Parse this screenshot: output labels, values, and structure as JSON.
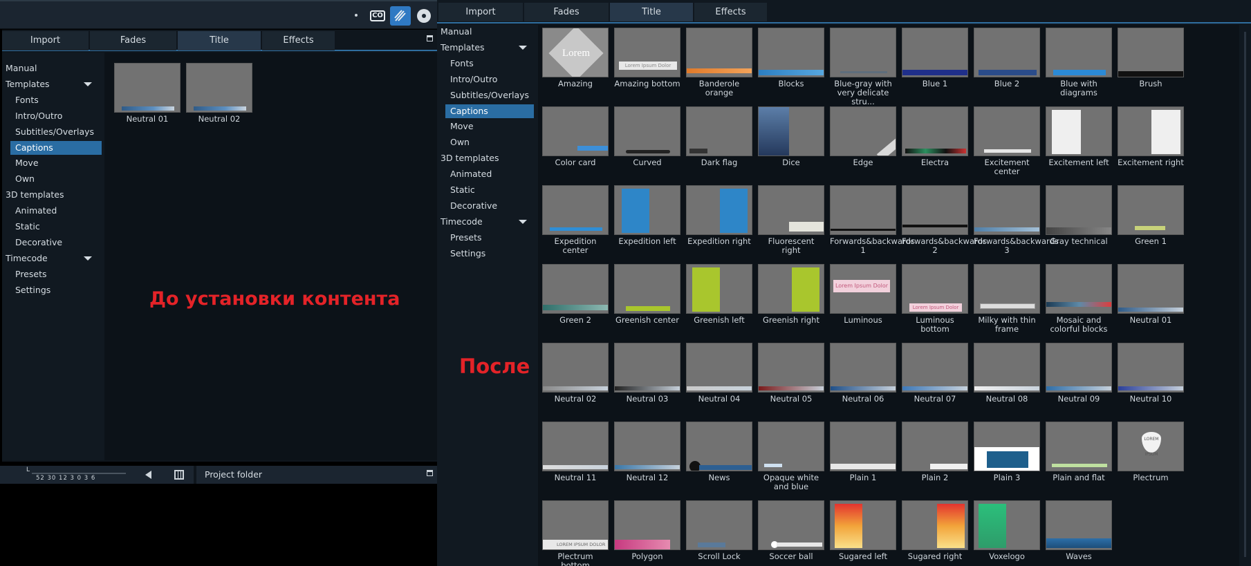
{
  "before": {
    "tabs": [
      "Import",
      "Fades",
      "Title",
      "Effects"
    ],
    "active_tab": 2,
    "nav": [
      {
        "label": "Manual",
        "level": 0
      },
      {
        "label": "Templates",
        "level": 0,
        "caret": true
      },
      {
        "label": "Fonts",
        "level": 1
      },
      {
        "label": "Intro/Outro",
        "level": 1
      },
      {
        "label": "Subtitles/Overlays",
        "level": 1
      },
      {
        "label": "Captions",
        "level": 1,
        "selected": true
      },
      {
        "label": "Move",
        "level": 1
      },
      {
        "label": "Own",
        "level": 1
      },
      {
        "label": "3D templates",
        "level": 0
      },
      {
        "label": "Animated",
        "level": 1
      },
      {
        "label": "Static",
        "level": 1
      },
      {
        "label": "Decorative",
        "level": 1
      },
      {
        "label": "Timecode",
        "level": 0,
        "caret": true
      },
      {
        "label": "Presets",
        "level": 1
      },
      {
        "label": "Settings",
        "level": 1
      }
    ],
    "templates": [
      "Neutral 01",
      "Neutral 02"
    ],
    "toolbar_icons": [
      "co-icon",
      "pen-tool-icon",
      "disc-icon"
    ],
    "mixer": {
      "channel": "L",
      "scale": "52  30   12      3  0  3  6"
    },
    "project_folder": "Project folder",
    "annotation": "До установки контента"
  },
  "after": {
    "tabs": [
      "Import",
      "Fades",
      "Title",
      "Effects"
    ],
    "active_tab": 2,
    "nav": [
      {
        "label": "Manual",
        "level": 0
      },
      {
        "label": "Templates",
        "level": 0,
        "caret": true
      },
      {
        "label": "Fonts",
        "level": 1
      },
      {
        "label": "Intro/Outro",
        "level": 1
      },
      {
        "label": "Subtitles/Overlays",
        "level": 1
      },
      {
        "label": "Captions",
        "level": 1,
        "selected": true
      },
      {
        "label": "Move",
        "level": 1
      },
      {
        "label": "Own",
        "level": 1
      },
      {
        "label": "3D templates",
        "level": 0
      },
      {
        "label": "Animated",
        "level": 1
      },
      {
        "label": "Static",
        "level": 1
      },
      {
        "label": "Decorative",
        "level": 1
      },
      {
        "label": "Timecode",
        "level": 0,
        "caret": true
      },
      {
        "label": "Presets",
        "level": 1
      },
      {
        "label": "Settings",
        "level": 1
      }
    ],
    "templates": [
      "Amazing",
      "Amazing bottom",
      "Banderole orange",
      "Blocks",
      "Blue-gray with very delicate stru...",
      "Blue 1",
      "Blue 2",
      "Blue with diagrams",
      "Brush",
      "Color card",
      "Curved",
      "Dark flag",
      "Dice",
      "Edge",
      "Electra",
      "Excitement center",
      "Excitement left",
      "Excitement right",
      "Expedition center",
      "Expedition left",
      "Expedition right",
      "Fluorescent right",
      "Forwards&backwards 1",
      "Forwards&backwards 2",
      "Forwards&backwards 3",
      "Gray technical",
      "Green 1",
      "Green 2",
      "Greenish center",
      "Greenish left",
      "Greenish right",
      "Luminous",
      "Luminous bottom",
      "Milky with thin frame",
      "Mosaic and colorful blocks",
      "Neutral 01",
      "Neutral 02",
      "Neutral 03",
      "Neutral 04",
      "Neutral 05",
      "Neutral 06",
      "Neutral 07",
      "Neutral 08",
      "Neutral 09",
      "Neutral 10",
      "Neutral 11",
      "Neutral 12",
      "News",
      "Opaque white and blue",
      "Plain 1",
      "Plain 2",
      "Plain 3",
      "Plain and flat",
      "Plectrum",
      "Plectrum bottom",
      "Polygon",
      "Scroll Lock",
      "Soccer ball",
      "Sugared left",
      "Sugared right",
      "Voxelogo",
      "Waves"
    ],
    "thumb_text": {
      "lorem": "Lorem",
      "lorem_ipsum_dolor": "Lorem Ipsum Dolor",
      "lorem_ipsum": "LOREM IPSUM",
      "lorem_ipsum_dolor_sit": "LOREM IPSUM DOLOR SIT"
    },
    "annotation": "После"
  }
}
